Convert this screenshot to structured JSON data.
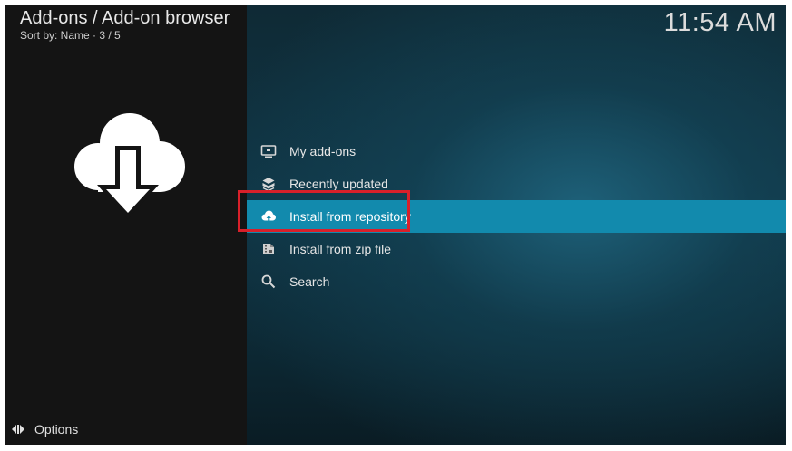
{
  "header": {
    "title": "Add-ons / Add-on browser",
    "subtitle": "Sort by: Name · 3 / 5"
  },
  "clock": "11:54 AM",
  "hero_icon": "cloud-download-icon",
  "menu": {
    "items": [
      {
        "label": "My add-ons",
        "icon": "monitor-icon",
        "selected": false
      },
      {
        "label": "Recently updated",
        "icon": "box-refresh-icon",
        "selected": false
      },
      {
        "label": "Install from repository",
        "icon": "cloud-upload-icon",
        "selected": true
      },
      {
        "label": "Install from zip file",
        "icon": "zip-file-icon",
        "selected": false
      },
      {
        "label": "Search",
        "icon": "search-icon",
        "selected": false
      }
    ]
  },
  "footer": {
    "options_label": "Options",
    "options_icon": "options-icon"
  },
  "colors": {
    "selected_row": "#128aad",
    "annotation_box": "#d8202a",
    "left_panel": "#141414"
  }
}
